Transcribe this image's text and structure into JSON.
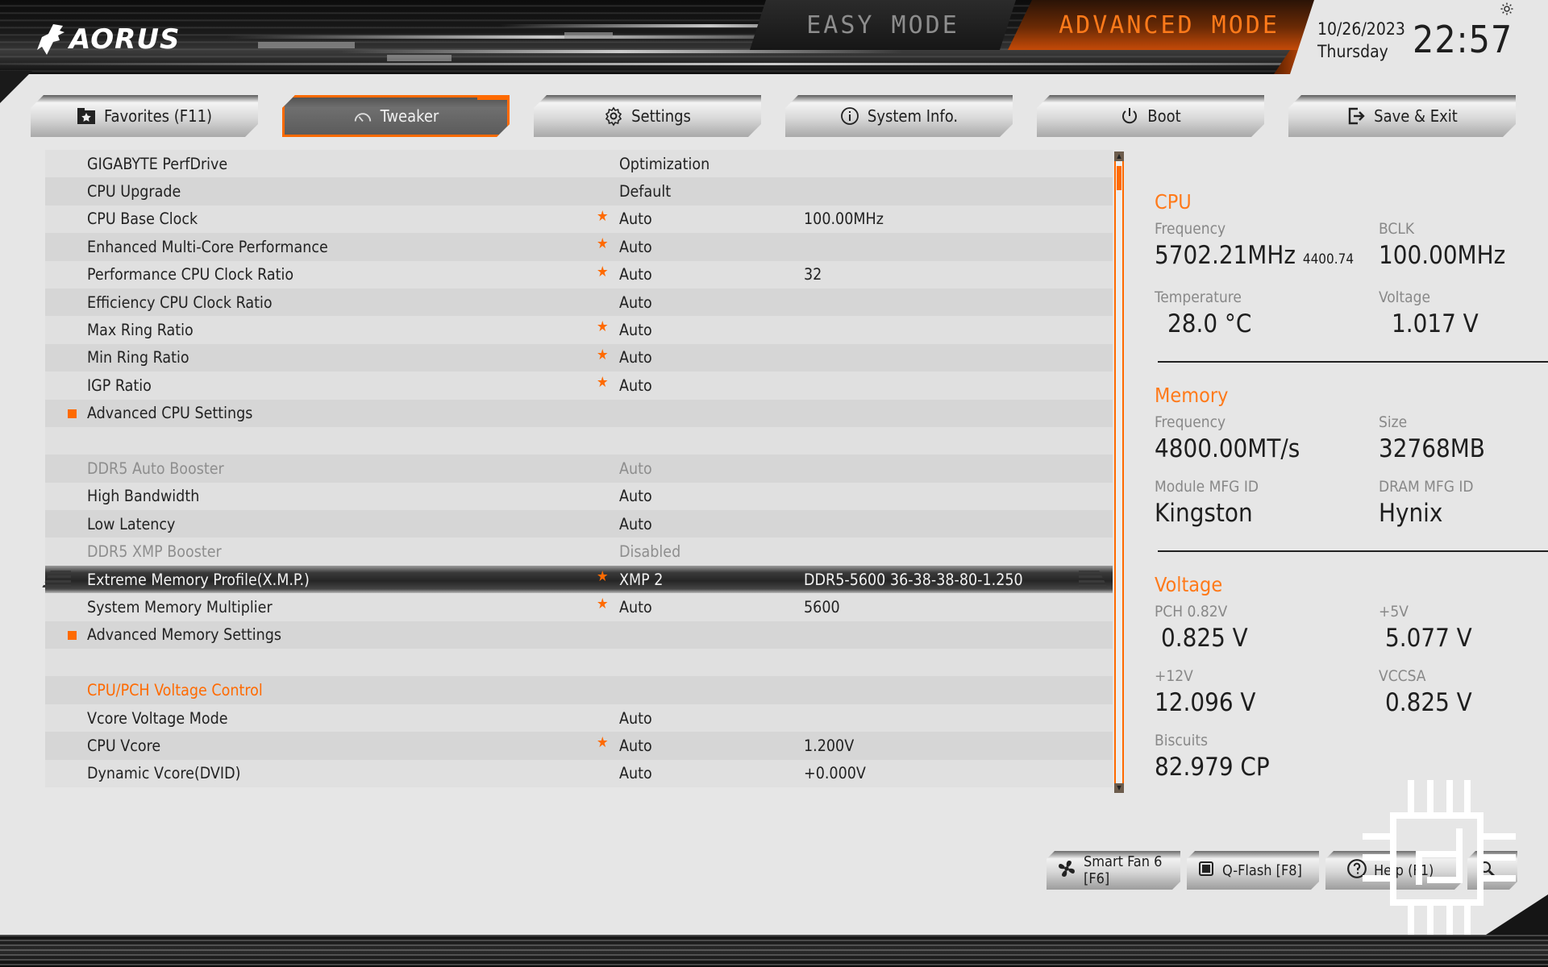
{
  "header": {
    "brand": "AORUS",
    "modes": {
      "easy": "EASY MODE",
      "advanced": "ADVANCED MODE",
      "active": "advanced"
    },
    "date": "10/26/2023",
    "weekday": "Thursday",
    "time": "22:57"
  },
  "tabs": [
    {
      "label": "Favorites (F11)",
      "icon": "star-folder-icon",
      "active": false
    },
    {
      "label": "Tweaker",
      "icon": "speedometer-icon",
      "active": true
    },
    {
      "label": "Settings",
      "icon": "gear-icon",
      "active": false
    },
    {
      "label": "System Info.",
      "icon": "info-icon",
      "active": false
    },
    {
      "label": "Boot",
      "icon": "power-icon",
      "active": false
    },
    {
      "label": "Save & Exit",
      "icon": "exit-icon",
      "active": false
    }
  ],
  "settings": [
    {
      "label": "GIGABYTE PerfDrive",
      "value": "Optimization",
      "extra": "",
      "starred": false
    },
    {
      "label": "CPU Upgrade",
      "value": "Default",
      "extra": "",
      "starred": false
    },
    {
      "label": "CPU Base Clock",
      "value": "Auto",
      "extra": "100.00MHz",
      "starred": true
    },
    {
      "label": "Enhanced Multi-Core Performance",
      "value": "Auto",
      "extra": "",
      "starred": true
    },
    {
      "label": "Performance CPU Clock Ratio",
      "value": "Auto",
      "extra": "32",
      "starred": true
    },
    {
      "label": "Efficiency CPU Clock Ratio",
      "value": "Auto",
      "extra": "",
      "starred": false
    },
    {
      "label": "Max Ring Ratio",
      "value": "Auto",
      "extra": "",
      "starred": true
    },
    {
      "label": "Min Ring Ratio",
      "value": "Auto",
      "extra": "",
      "starred": true
    },
    {
      "label": "IGP Ratio",
      "value": "Auto",
      "extra": "",
      "starred": true
    },
    {
      "label": "Advanced CPU Settings",
      "value": "",
      "extra": "",
      "submenu": true
    },
    {
      "label": "",
      "value": "",
      "extra": ""
    },
    {
      "label": "DDR5 Auto Booster",
      "value": "Auto",
      "extra": "",
      "disabled": true
    },
    {
      "label": "High Bandwidth",
      "value": "Auto",
      "extra": ""
    },
    {
      "label": "Low Latency",
      "value": "Auto",
      "extra": ""
    },
    {
      "label": "DDR5 XMP Booster",
      "value": "Disabled",
      "extra": "",
      "disabled": true
    },
    {
      "label": "Extreme Memory Profile(X.M.P.)",
      "value": "XMP 2",
      "extra": "DDR5-5600 36-38-38-80-1.250",
      "starred": true,
      "selected": true
    },
    {
      "label": "System Memory Multiplier",
      "value": "Auto",
      "extra": "5600",
      "starred": true
    },
    {
      "label": "Advanced Memory Settings",
      "value": "",
      "extra": "",
      "submenu": true
    },
    {
      "label": "",
      "value": "",
      "extra": ""
    },
    {
      "label": "CPU/PCH Voltage Control",
      "value": "",
      "extra": "",
      "section": true
    },
    {
      "label": "Vcore Voltage Mode",
      "value": "Auto",
      "extra": ""
    },
    {
      "label": "CPU Vcore",
      "value": "Auto",
      "extra": "1.200V",
      "starred": true
    },
    {
      "label": "Dynamic Vcore(DVID)",
      "value": "Auto",
      "extra": "+0.000V"
    }
  ],
  "scrollbar": {
    "position_fraction": 0.0
  },
  "info": {
    "cpu": {
      "title": "CPU",
      "frequency_label": "Frequency",
      "frequency": "5702.21MHz",
      "frequency_sub": "4400.74",
      "bclk_label": "BCLK",
      "bclk": "100.00MHz",
      "temperature_label": "Temperature",
      "temperature": "28.0 °C",
      "voltage_label": "Voltage",
      "voltage": "1.017 V"
    },
    "memory": {
      "title": "Memory",
      "frequency_label": "Frequency",
      "frequency": "4800.00MT/s",
      "size_label": "Size",
      "size": "32768MB",
      "module_label": "Module MFG ID",
      "module": "Kingston",
      "dram_label": "DRAM MFG ID",
      "dram": "Hynix"
    },
    "voltage": {
      "title": "Voltage",
      "pch_label": "PCH 0.82V",
      "pch": "0.825 V",
      "p5_label": "+5V",
      "p5": "5.077 V",
      "p12_label": "+12V",
      "p12": "12.096 V",
      "vccsa_label": "VCCSA",
      "vccsa": "0.825 V",
      "biscuits_label": "Biscuits",
      "biscuits": "82.979 CP"
    }
  },
  "bottom_buttons": [
    {
      "label": "Smart Fan 6 [F6]",
      "icon": "fan-icon"
    },
    {
      "label": "Q-Flash [F8]",
      "icon": "chip-icon"
    },
    {
      "label": "Help (F1)",
      "icon": "help-icon"
    },
    {
      "label": "",
      "icon": "search-icon"
    }
  ],
  "colors": {
    "accent": "#ff6a00",
    "background": "#e6e6e6",
    "text": "#1e1e1e",
    "muted": "#888888"
  }
}
